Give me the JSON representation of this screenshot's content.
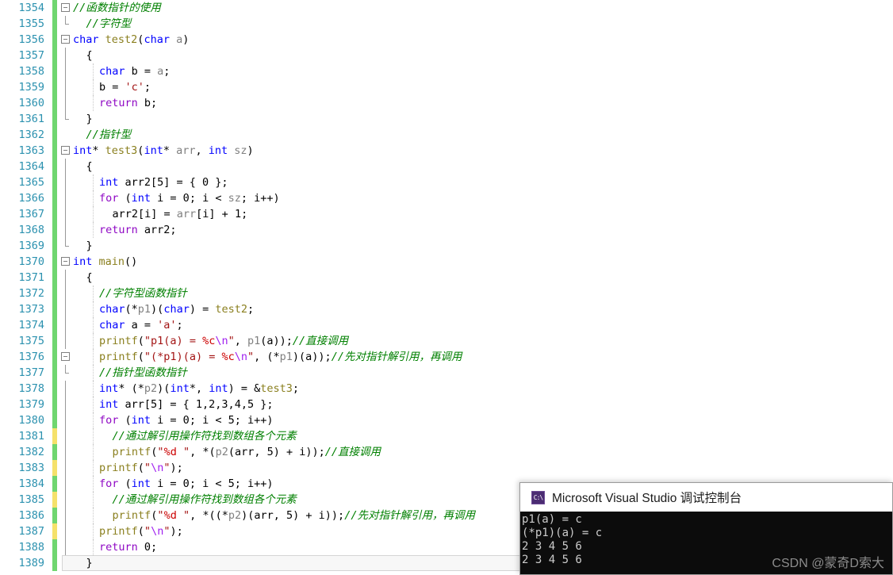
{
  "editor": {
    "first_line_number": 1354,
    "gutter": {
      "line_number_color": "#2b91af",
      "change_bar_saved_color": "#6fd66f",
      "change_bar_unsaved_color": "#f5e16b"
    },
    "lines": [
      {
        "n": "1354",
        "chg": "green",
        "outline": "box",
        "indent": 0,
        "guides": 0,
        "tokens": [
          {
            "t": "//函数指针的使用",
            "c": "cmt"
          }
        ]
      },
      {
        "n": "1355",
        "chg": "green",
        "outline": "corner",
        "indent": 1,
        "guides": 0,
        "tokens": [
          {
            "t": "//字符型",
            "c": "cmt"
          }
        ]
      },
      {
        "n": "1356",
        "chg": "green",
        "outline": "box",
        "indent": 0,
        "guides": 0,
        "tokens": [
          {
            "t": "char",
            "c": "kw"
          },
          {
            "t": " ",
            "c": "plain"
          },
          {
            "t": "test2",
            "c": "fn"
          },
          {
            "t": "(",
            "c": "plain"
          },
          {
            "t": "char",
            "c": "kw"
          },
          {
            "t": " ",
            "c": "plain"
          },
          {
            "t": "a",
            "c": "id"
          },
          {
            "t": ")",
            "c": "plain"
          }
        ]
      },
      {
        "n": "1357",
        "chg": "green",
        "outline": "vline",
        "indent": 1,
        "guides": 0,
        "tokens": [
          {
            "t": "{",
            "c": "plain"
          }
        ]
      },
      {
        "n": "1358",
        "chg": "green",
        "outline": "vline",
        "indent": 2,
        "guides": 1,
        "tokens": [
          {
            "t": "char",
            "c": "kw"
          },
          {
            "t": " b = ",
            "c": "plain"
          },
          {
            "t": "a",
            "c": "id"
          },
          {
            "t": ";",
            "c": "plain"
          }
        ]
      },
      {
        "n": "1359",
        "chg": "green",
        "outline": "vline",
        "indent": 2,
        "guides": 1,
        "tokens": [
          {
            "t": "b = ",
            "c": "plain"
          },
          {
            "t": "'c'",
            "c": "str"
          },
          {
            "t": ";",
            "c": "plain"
          }
        ]
      },
      {
        "n": "1360",
        "chg": "green",
        "outline": "vline",
        "indent": 2,
        "guides": 1,
        "tokens": [
          {
            "t": "return",
            "c": "ctl"
          },
          {
            "t": " b;",
            "c": "plain"
          }
        ]
      },
      {
        "n": "1361",
        "chg": "green",
        "outline": "vlineend",
        "indent": 1,
        "guides": 0,
        "tokens": [
          {
            "t": "}",
            "c": "plain"
          }
        ]
      },
      {
        "n": "1362",
        "chg": "green",
        "outline": "none",
        "indent": 1,
        "guides": 0,
        "tokens": [
          {
            "t": "//指针型",
            "c": "cmt"
          }
        ]
      },
      {
        "n": "1363",
        "chg": "green",
        "outline": "box",
        "indent": 0,
        "guides": 0,
        "tokens": [
          {
            "t": "int",
            "c": "kw"
          },
          {
            "t": "* ",
            "c": "plain"
          },
          {
            "t": "test3",
            "c": "fn"
          },
          {
            "t": "(",
            "c": "plain"
          },
          {
            "t": "int",
            "c": "kw"
          },
          {
            "t": "* ",
            "c": "plain"
          },
          {
            "t": "arr",
            "c": "id"
          },
          {
            "t": ", ",
            "c": "plain"
          },
          {
            "t": "int",
            "c": "kw"
          },
          {
            "t": " ",
            "c": "plain"
          },
          {
            "t": "sz",
            "c": "id"
          },
          {
            "t": ")",
            "c": "plain"
          }
        ]
      },
      {
        "n": "1364",
        "chg": "green",
        "outline": "vline",
        "indent": 1,
        "guides": 0,
        "tokens": [
          {
            "t": "{",
            "c": "plain"
          }
        ]
      },
      {
        "n": "1365",
        "chg": "green",
        "outline": "vline",
        "indent": 2,
        "guides": 1,
        "tokens": [
          {
            "t": "int",
            "c": "kw"
          },
          {
            "t": " arr2[5] = { 0 };",
            "c": "plain"
          }
        ]
      },
      {
        "n": "1366",
        "chg": "green",
        "outline": "vline",
        "indent": 2,
        "guides": 1,
        "tokens": [
          {
            "t": "for",
            "c": "ctl"
          },
          {
            "t": " (",
            "c": "plain"
          },
          {
            "t": "int",
            "c": "kw"
          },
          {
            "t": " i = 0; i < ",
            "c": "plain"
          },
          {
            "t": "sz",
            "c": "id"
          },
          {
            "t": "; i++)",
            "c": "plain"
          }
        ]
      },
      {
        "n": "1367",
        "chg": "green",
        "outline": "vline",
        "indent": 3,
        "guides": 1,
        "tokens": [
          {
            "t": "arr2[i] = ",
            "c": "plain"
          },
          {
            "t": "arr",
            "c": "id"
          },
          {
            "t": "[i] + 1;",
            "c": "plain"
          }
        ]
      },
      {
        "n": "1368",
        "chg": "green",
        "outline": "vline",
        "indent": 2,
        "guides": 1,
        "tokens": [
          {
            "t": "return",
            "c": "ctl"
          },
          {
            "t": " arr2;",
            "c": "plain"
          }
        ]
      },
      {
        "n": "1369",
        "chg": "green",
        "outline": "vlineend",
        "indent": 1,
        "guides": 0,
        "tokens": [
          {
            "t": "}",
            "c": "plain"
          }
        ]
      },
      {
        "n": "1370",
        "chg": "green",
        "outline": "box",
        "indent": 0,
        "guides": 0,
        "tokens": [
          {
            "t": "int",
            "c": "kw"
          },
          {
            "t": " ",
            "c": "plain"
          },
          {
            "t": "main",
            "c": "fn"
          },
          {
            "t": "()",
            "c": "plain"
          }
        ]
      },
      {
        "n": "1371",
        "chg": "green",
        "outline": "vline",
        "indent": 1,
        "guides": 0,
        "tokens": [
          {
            "t": "{",
            "c": "plain"
          }
        ]
      },
      {
        "n": "1372",
        "chg": "green",
        "outline": "vline",
        "indent": 2,
        "guides": 1,
        "tokens": [
          {
            "t": "//字符型函数指针",
            "c": "cmt"
          }
        ]
      },
      {
        "n": "1373",
        "chg": "green",
        "outline": "vline",
        "indent": 2,
        "guides": 1,
        "tokens": [
          {
            "t": "char",
            "c": "kw"
          },
          {
            "t": "(*",
            "c": "plain"
          },
          {
            "t": "p1",
            "c": "id"
          },
          {
            "t": ")(",
            "c": "plain"
          },
          {
            "t": "char",
            "c": "kw"
          },
          {
            "t": ") = ",
            "c": "plain"
          },
          {
            "t": "test2",
            "c": "fn"
          },
          {
            "t": ";",
            "c": "plain"
          }
        ]
      },
      {
        "n": "1374",
        "chg": "green",
        "outline": "vline",
        "indent": 2,
        "guides": 1,
        "tokens": [
          {
            "t": "char",
            "c": "kw"
          },
          {
            "t": " a = ",
            "c": "plain"
          },
          {
            "t": "'a'",
            "c": "str"
          },
          {
            "t": ";",
            "c": "plain"
          }
        ]
      },
      {
        "n": "1375",
        "chg": "green",
        "outline": "vline",
        "indent": 2,
        "guides": 1,
        "tokens": [
          {
            "t": "printf",
            "c": "fn"
          },
          {
            "t": "(",
            "c": "plain"
          },
          {
            "t": "\"p1(a) = ",
            "c": "str"
          },
          {
            "t": "%c",
            "c": "fmt"
          },
          {
            "t": "\\n",
            "c": "esc"
          },
          {
            "t": "\"",
            "c": "str"
          },
          {
            "t": ", ",
            "c": "plain"
          },
          {
            "t": "p1",
            "c": "id"
          },
          {
            "t": "(a));",
            "c": "plain"
          },
          {
            "t": "//直接调用",
            "c": "cmt"
          }
        ]
      },
      {
        "n": "1376",
        "chg": "green",
        "outline": "boxmid",
        "indent": 2,
        "guides": 1,
        "tokens": [
          {
            "t": "printf",
            "c": "fn"
          },
          {
            "t": "(",
            "c": "plain"
          },
          {
            "t": "\"(*p1)(a) = ",
            "c": "str"
          },
          {
            "t": "%c",
            "c": "fmt"
          },
          {
            "t": "\\n",
            "c": "esc"
          },
          {
            "t": "\"",
            "c": "str"
          },
          {
            "t": ", (*",
            "c": "plain"
          },
          {
            "t": "p1",
            "c": "id"
          },
          {
            "t": ")(a));",
            "c": "plain"
          },
          {
            "t": "//先对指针解引用，再调用",
            "c": "cmt"
          }
        ]
      },
      {
        "n": "1377",
        "chg": "green",
        "outline": "cornermid",
        "indent": 2,
        "guides": 1,
        "tokens": [
          {
            "t": "//指针型函数指针",
            "c": "cmt"
          }
        ]
      },
      {
        "n": "1378",
        "chg": "green",
        "outline": "vline",
        "indent": 2,
        "guides": 1,
        "tokens": [
          {
            "t": "int",
            "c": "kw"
          },
          {
            "t": "* (*",
            "c": "plain"
          },
          {
            "t": "p2",
            "c": "id"
          },
          {
            "t": ")(",
            "c": "plain"
          },
          {
            "t": "int",
            "c": "kw"
          },
          {
            "t": "*, ",
            "c": "plain"
          },
          {
            "t": "int",
            "c": "kw"
          },
          {
            "t": ") = &",
            "c": "plain"
          },
          {
            "t": "test3",
            "c": "fn"
          },
          {
            "t": ";",
            "c": "plain"
          }
        ]
      },
      {
        "n": "1379",
        "chg": "green",
        "outline": "vline",
        "indent": 2,
        "guides": 1,
        "tokens": [
          {
            "t": "int",
            "c": "kw"
          },
          {
            "t": " arr[5] = { 1,2,3,4,5 };",
            "c": "plain"
          }
        ]
      },
      {
        "n": "1380",
        "chg": "green",
        "outline": "vline",
        "indent": 2,
        "guides": 1,
        "tokens": [
          {
            "t": "for",
            "c": "ctl"
          },
          {
            "t": " (",
            "c": "plain"
          },
          {
            "t": "int",
            "c": "kw"
          },
          {
            "t": " i = 0; i < 5; i++)",
            "c": "plain"
          }
        ]
      },
      {
        "n": "1381",
        "chg": "yellow",
        "outline": "vline",
        "indent": 3,
        "guides": 1,
        "tokens": [
          {
            "t": "//通过解引用操作符找到数组各个元素",
            "c": "cmt"
          }
        ]
      },
      {
        "n": "1382",
        "chg": "green",
        "outline": "vline",
        "indent": 3,
        "guides": 1,
        "tokens": [
          {
            "t": "printf",
            "c": "fn"
          },
          {
            "t": "(",
            "c": "plain"
          },
          {
            "t": "\"",
            "c": "str"
          },
          {
            "t": "%d",
            "c": "fmt"
          },
          {
            "t": " \"",
            "c": "str"
          },
          {
            "t": ", *(",
            "c": "plain"
          },
          {
            "t": "p2",
            "c": "id"
          },
          {
            "t": "(arr, 5) + i));",
            "c": "plain"
          },
          {
            "t": "//直接调用",
            "c": "cmt"
          }
        ]
      },
      {
        "n": "1383",
        "chg": "yellow",
        "outline": "vline",
        "indent": 2,
        "guides": 1,
        "tokens": [
          {
            "t": "printf",
            "c": "fn"
          },
          {
            "t": "(",
            "c": "plain"
          },
          {
            "t": "\"",
            "c": "str"
          },
          {
            "t": "\\n",
            "c": "esc"
          },
          {
            "t": "\"",
            "c": "str"
          },
          {
            "t": ");",
            "c": "plain"
          }
        ]
      },
      {
        "n": "1384",
        "chg": "green",
        "outline": "vline",
        "indent": 2,
        "guides": 1,
        "tokens": [
          {
            "t": "for",
            "c": "ctl"
          },
          {
            "t": " (",
            "c": "plain"
          },
          {
            "t": "int",
            "c": "kw"
          },
          {
            "t": " i = 0; i < 5; i++)",
            "c": "plain"
          }
        ]
      },
      {
        "n": "1385",
        "chg": "yellow",
        "outline": "vline",
        "indent": 3,
        "guides": 1,
        "tokens": [
          {
            "t": "//通过解引用操作符找到数组各个元素",
            "c": "cmt"
          }
        ]
      },
      {
        "n": "1386",
        "chg": "green",
        "outline": "vline",
        "indent": 3,
        "guides": 1,
        "tokens": [
          {
            "t": "printf",
            "c": "fn"
          },
          {
            "t": "(",
            "c": "plain"
          },
          {
            "t": "\"",
            "c": "str"
          },
          {
            "t": "%d",
            "c": "fmt"
          },
          {
            "t": " \"",
            "c": "str"
          },
          {
            "t": ", *((*",
            "c": "plain"
          },
          {
            "t": "p2",
            "c": "id"
          },
          {
            "t": ")(arr, 5) + i));",
            "c": "plain"
          },
          {
            "t": "//先对指针解引用，再调用",
            "c": "cmt"
          }
        ]
      },
      {
        "n": "1387",
        "chg": "yellow",
        "outline": "vline",
        "indent": 2,
        "guides": 1,
        "tokens": [
          {
            "t": "printf",
            "c": "fn"
          },
          {
            "t": "(",
            "c": "plain"
          },
          {
            "t": "\"",
            "c": "str"
          },
          {
            "t": "\\n",
            "c": "esc"
          },
          {
            "t": "\"",
            "c": "str"
          },
          {
            "t": ");",
            "c": "plain"
          }
        ]
      },
      {
        "n": "1388",
        "chg": "green",
        "outline": "vline",
        "indent": 2,
        "guides": 1,
        "tokens": [
          {
            "t": "return",
            "c": "ctl"
          },
          {
            "t": " 0;",
            "c": "plain"
          }
        ]
      },
      {
        "n": "1389",
        "chg": "green",
        "outline": "none",
        "indent": 1,
        "guides": 0,
        "current": true,
        "tokens": [
          {
            "t": "}",
            "c": "plain"
          }
        ]
      }
    ]
  },
  "console": {
    "icon": "console-app-icon",
    "icon_label": "C:\\",
    "title": "Microsoft Visual Studio 调试控制台",
    "output_lines": [
      "p1(a) = c",
      "(*p1)(a) = c",
      "2 3 4 5 6",
      "2 3 4 5 6"
    ],
    "watermark": "CSDN @蒙奇D索大"
  }
}
